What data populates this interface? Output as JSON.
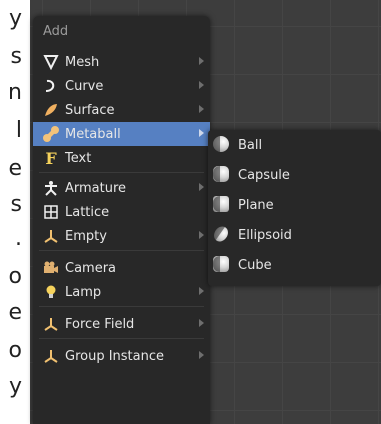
{
  "document_edge": [
    "y",
    "s",
    "n",
    "l",
    "e",
    "s",
    ".",
    "o",
    "e",
    "o",
    "y"
  ],
  "menu": {
    "title": "Add",
    "items": [
      {
        "label": "Mesh",
        "icon": "mesh-icon",
        "submenu": true
      },
      {
        "label": "Curve",
        "icon": "curve-icon",
        "submenu": true
      },
      {
        "label": "Surface",
        "icon": "surface-icon",
        "submenu": true
      },
      {
        "label": "Metaball",
        "icon": "metaball-icon",
        "submenu": true,
        "highlighted": true
      },
      {
        "label": "Text",
        "icon": "text-icon",
        "submenu": false
      },
      {
        "label": "Armature",
        "icon": "armature-icon",
        "submenu": true
      },
      {
        "label": "Lattice",
        "icon": "lattice-icon",
        "submenu": false
      },
      {
        "label": "Empty",
        "icon": "empty-icon",
        "submenu": true
      },
      {
        "label": "Camera",
        "icon": "camera-icon",
        "submenu": false
      },
      {
        "label": "Lamp",
        "icon": "lamp-icon",
        "submenu": true
      },
      {
        "label": "Force Field",
        "icon": "force-field-icon",
        "submenu": true
      },
      {
        "label": "Group Instance",
        "icon": "group-instance-icon",
        "submenu": true
      }
    ]
  },
  "submenu": {
    "items": [
      {
        "label": "Ball",
        "icon": "metaball-ball-icon"
      },
      {
        "label": "Capsule",
        "icon": "metaball-capsule-icon"
      },
      {
        "label": "Plane",
        "icon": "metaball-plane-icon"
      },
      {
        "label": "Ellipsoid",
        "icon": "metaball-ellipsoid-icon"
      },
      {
        "label": "Cube",
        "icon": "metaball-cube-icon"
      }
    ]
  },
  "colors": {
    "menu_bg": "#282828",
    "highlight": "#5680c2",
    "viewport_bg": "#3d3d3d",
    "text": "#e6e6e6"
  }
}
